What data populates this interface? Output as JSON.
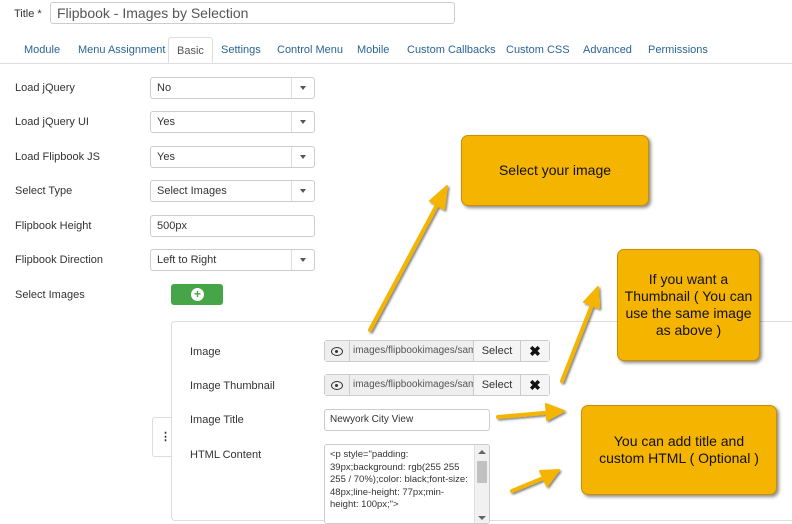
{
  "title_field": {
    "label": "Title *",
    "value": "Flipbook - Images by Selection"
  },
  "tabs": [
    {
      "label": "Module"
    },
    {
      "label": "Menu Assignment"
    },
    {
      "label": "Basic"
    },
    {
      "label": "Settings"
    },
    {
      "label": "Control Menu"
    },
    {
      "label": "Mobile"
    },
    {
      "label": "Custom Callbacks"
    },
    {
      "label": "Custom CSS"
    },
    {
      "label": "Advanced"
    },
    {
      "label": "Permissions"
    }
  ],
  "active_tab": "Basic",
  "fields": {
    "load_jquery": {
      "label": "Load jQuery",
      "value": "No"
    },
    "load_jquery_ui": {
      "label": "Load jQuery UI",
      "value": "Yes"
    },
    "load_flipbook_js": {
      "label": "Load Flipbook JS",
      "value": "Yes"
    },
    "select_type": {
      "label": "Select Type",
      "value": "Select Images"
    },
    "flipbook_height": {
      "label": "Flipbook Height",
      "value": "500px"
    },
    "flipbook_direction": {
      "label": "Flipbook Direction",
      "value": "Left to Right"
    },
    "select_images": {
      "label": "Select Images"
    }
  },
  "subform": {
    "image": {
      "label": "Image",
      "path": "images/flipbookimages/sam",
      "select_label": "Select"
    },
    "image_thumbnail": {
      "label": "Image Thumbnail",
      "path": "images/flipbookimages/sam",
      "select_label": "Select"
    },
    "image_title": {
      "label": "Image Title",
      "value": "Newyork City View"
    },
    "html_content": {
      "label": "HTML Content",
      "value": "<p style=\"padding: 39px;background: rgb(255 255 255 / 70%);color: black;font-size: 48px;line-height: 77px;min-height: 100px;\">"
    }
  },
  "callouts": {
    "select_image": "Select your image",
    "thumbnail": "If you want a Thumbnail ( You can use the same image as above )",
    "title_html": "You can add title and custom HTML ( Optional )"
  },
  "colors": {
    "callout": "#f5b400",
    "add_button": "#46a546",
    "tab_link": "#2a6496"
  }
}
